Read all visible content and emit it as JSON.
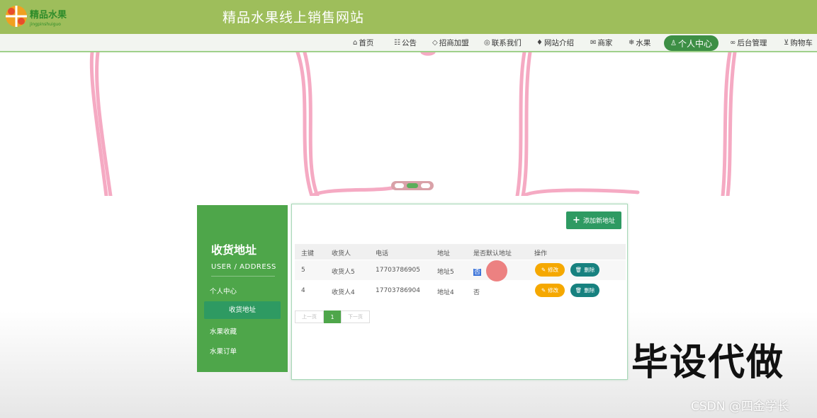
{
  "header": {
    "logo_text": "精品水果",
    "title": "精品水果线上销售网站"
  },
  "nav": {
    "items": [
      {
        "label": "首页",
        "icon": "home-icon"
      },
      {
        "label": "公告",
        "icon": "notice-icon"
      },
      {
        "label": "招商加盟",
        "icon": "tag-icon"
      },
      {
        "label": "联系我们",
        "icon": "location-icon"
      },
      {
        "label": "网站介绍",
        "icon": "graduation-cap-icon"
      },
      {
        "label": "商家",
        "icon": "mail-icon"
      },
      {
        "label": "水果",
        "icon": "snowflake-icon"
      },
      {
        "label": "个人中心",
        "icon": "user-icon",
        "active": true
      },
      {
        "label": "后台管理",
        "icon": "link-icon"
      },
      {
        "label": "购物车",
        "icon": "cart-icon"
      }
    ]
  },
  "sidebar": {
    "title": "收货地址",
    "subtitle": "USER / ADDRESS",
    "items": [
      {
        "label": "个人中心"
      },
      {
        "label": "收货地址",
        "active": true
      },
      {
        "label": "水果收藏"
      },
      {
        "label": "水果订单"
      }
    ]
  },
  "panel": {
    "add_button_label": "添加新地址",
    "columns": [
      "主键",
      "收货人",
      "电话",
      "地址",
      "是否默认地址",
      "操作"
    ],
    "rows": [
      {
        "id": "5",
        "name": "收货人5",
        "phone": "17703786905",
        "address": "地址5",
        "is_default": "否",
        "edit_label": "修改",
        "delete_label": "删除"
      },
      {
        "id": "4",
        "name": "收货人4",
        "phone": "17703786904",
        "address": "地址4",
        "is_default": "否",
        "edit_label": "修改",
        "delete_label": "删除"
      }
    ],
    "pagination": {
      "prev": "上一页",
      "current": "1",
      "next": "下一页"
    }
  },
  "overlay": {
    "promo_text": "毕设代做",
    "watermark": "CSDN @四金学长"
  },
  "colors": {
    "header_bg": "#9ebe5b",
    "accent_green": "#4ea64a",
    "active_green": "#2e9a62",
    "edit_orange": "#f5a800",
    "delete_teal": "#17817f"
  }
}
